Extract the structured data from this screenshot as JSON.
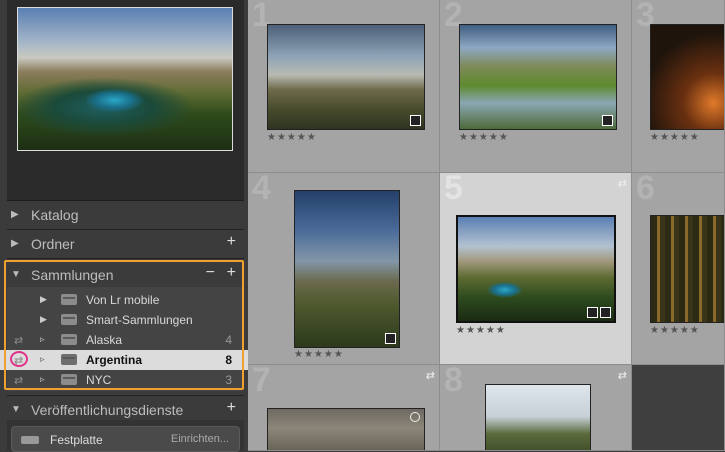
{
  "panels": {
    "katalog": "Katalog",
    "ordner": "Ordner",
    "sammlungen": "Sammlungen",
    "publish": "Veröffentlichungsdienste"
  },
  "collections": [
    {
      "name": "Von Lr mobile",
      "count": ""
    },
    {
      "name": "Smart-Sammlungen",
      "count": ""
    },
    {
      "name": "Alaska",
      "count": "4"
    },
    {
      "name": "Argentina",
      "count": "8"
    },
    {
      "name": "NYC",
      "count": "3"
    }
  ],
  "publish_item": {
    "name": "Festplatte",
    "action": "Einrichten..."
  },
  "grid": {
    "cell_numbers": [
      "1",
      "2",
      "3",
      "4",
      "5",
      "6",
      "7",
      "8"
    ],
    "stars": "★★★★★"
  },
  "colors": {
    "highlight": "#f0a030",
    "ring": "#e0308a"
  },
  "icons": [
    "triangle-right-icon",
    "triangle-down-icon",
    "plus-icon",
    "minus-icon",
    "folder-icon",
    "sync-arrows-icon",
    "drive-icon"
  ]
}
